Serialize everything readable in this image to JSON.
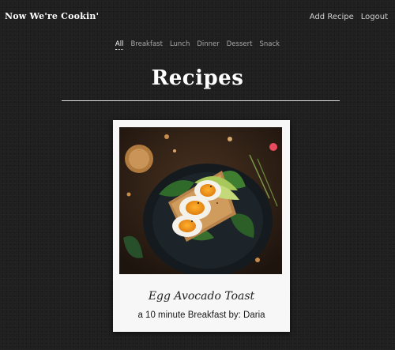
{
  "header": {
    "brand": "Now We're Cookin'",
    "links": [
      "Add Recipe",
      "Logout"
    ]
  },
  "filters": {
    "items": [
      "All",
      "Breakfast",
      "Lunch",
      "Dinner",
      "Dessert",
      "Snack"
    ],
    "active": "All"
  },
  "page": {
    "title": "Recipes"
  },
  "recipes": [
    {
      "title": "Egg Avocado Toast",
      "subtitle": "a 10 minute Breakfast by: Daria"
    }
  ]
}
